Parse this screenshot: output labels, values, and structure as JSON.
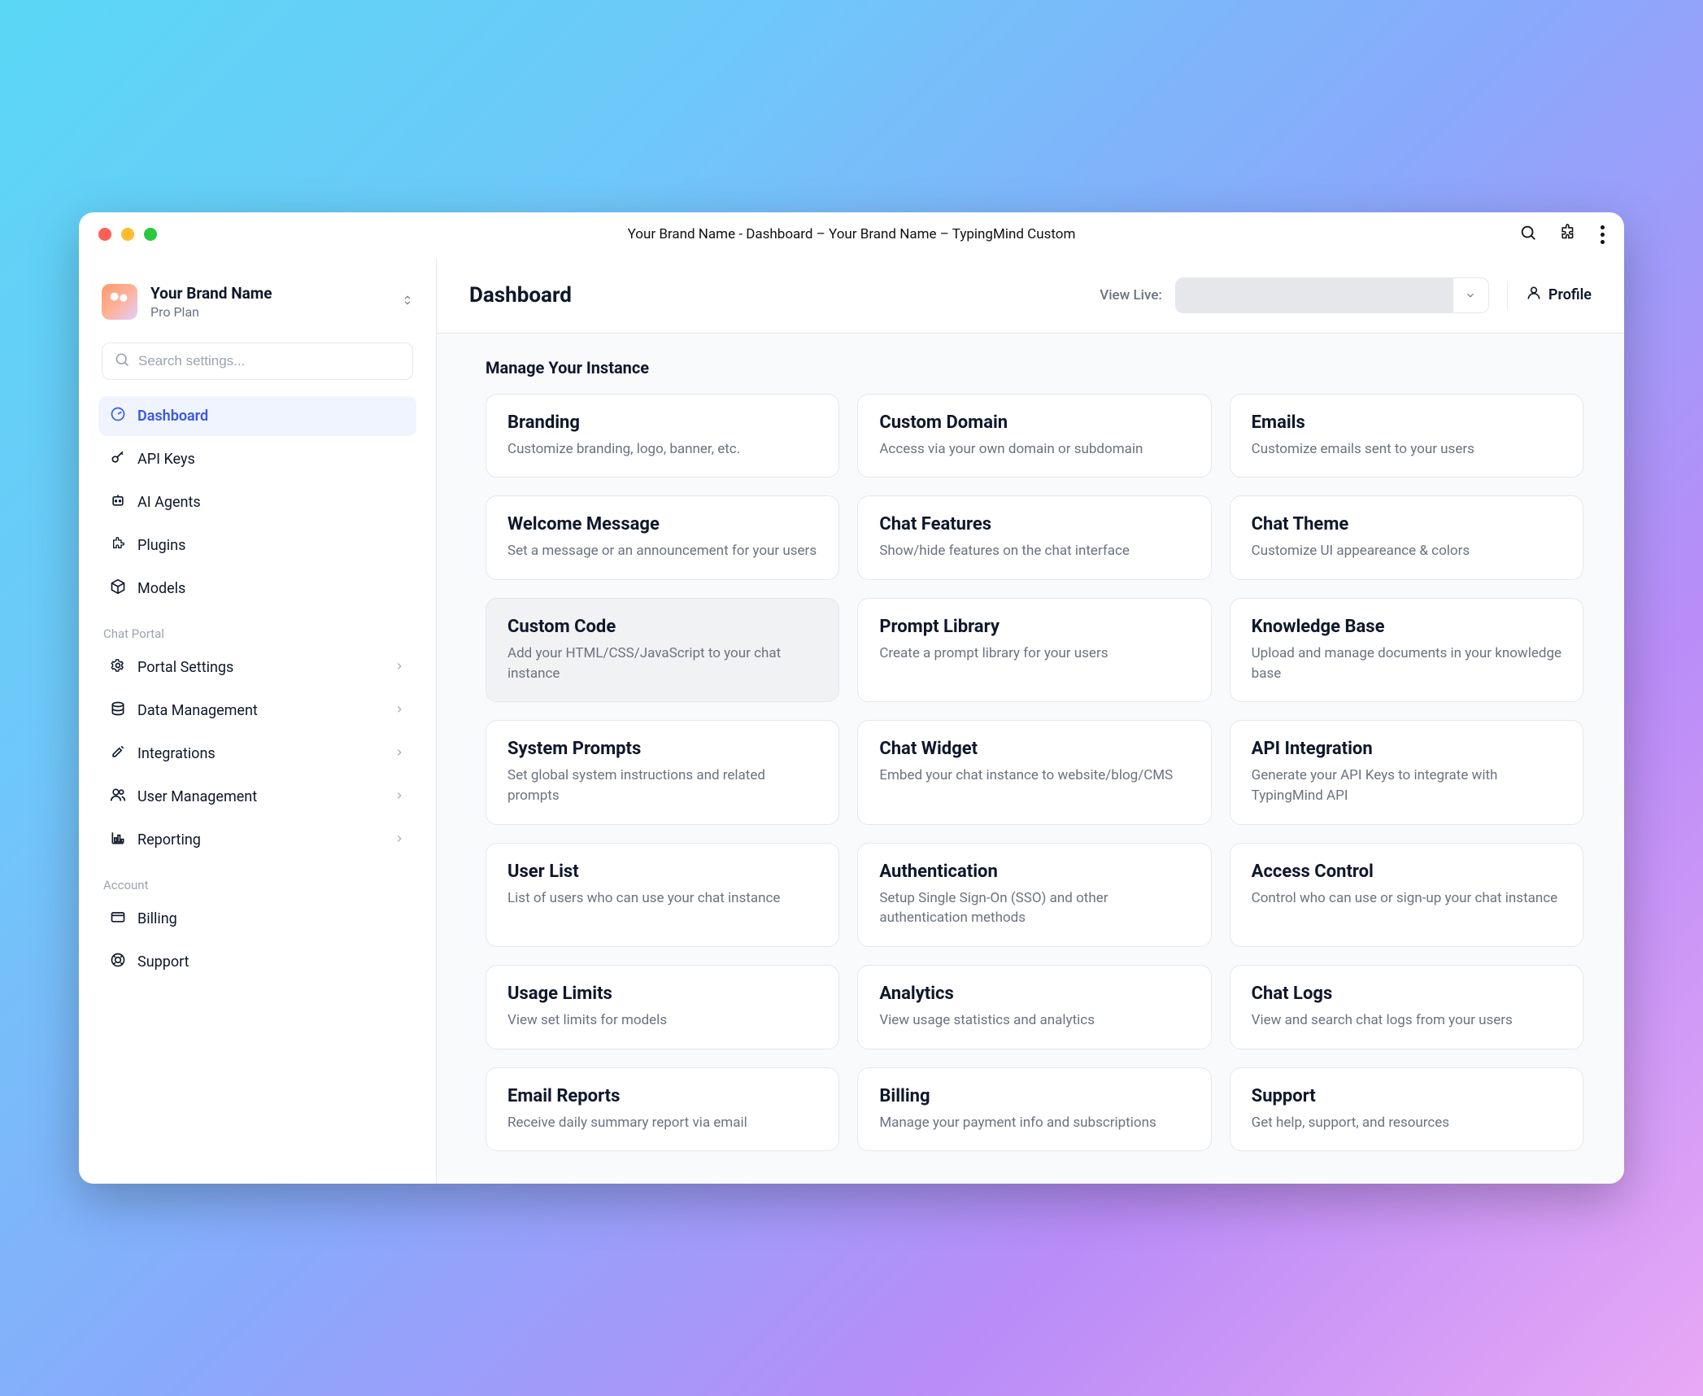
{
  "titlebar": {
    "title": "Your Brand Name - Dashboard – Your Brand Name – TypingMind Custom"
  },
  "brand": {
    "name": "Your Brand Name",
    "plan": "Pro Plan"
  },
  "search": {
    "placeholder": "Search settings..."
  },
  "nav": {
    "primary": [
      {
        "label": "Dashboard"
      },
      {
        "label": "API Keys"
      },
      {
        "label": "AI Agents"
      },
      {
        "label": "Plugins"
      },
      {
        "label": "Models"
      }
    ],
    "portal_label": "Chat Portal",
    "portal": [
      {
        "label": "Portal Settings"
      },
      {
        "label": "Data Management"
      },
      {
        "label": "Integrations"
      },
      {
        "label": "User Management"
      },
      {
        "label": "Reporting"
      }
    ],
    "account_label": "Account",
    "account": [
      {
        "label": "Billing"
      },
      {
        "label": "Support"
      }
    ]
  },
  "header": {
    "title": "Dashboard",
    "view_live_label": "View Live:",
    "profile_label": "Profile"
  },
  "content": {
    "section_title": "Manage Your Instance",
    "cards": [
      {
        "title": "Branding",
        "desc": "Customize branding, logo, banner, etc."
      },
      {
        "title": "Custom Domain",
        "desc": "Access via your own domain or subdomain"
      },
      {
        "title": "Emails",
        "desc": "Customize emails sent to your users"
      },
      {
        "title": "Welcome Message",
        "desc": "Set a message or an announcement for your users"
      },
      {
        "title": "Chat Features",
        "desc": "Show/hide features on the chat interface"
      },
      {
        "title": "Chat Theme",
        "desc": "Customize UI appeareance & colors"
      },
      {
        "title": "Custom Code",
        "desc": "Add your HTML/CSS/JavaScript to your chat instance"
      },
      {
        "title": "Prompt Library",
        "desc": "Create a prompt library for your users"
      },
      {
        "title": "Knowledge Base",
        "desc": "Upload and manage documents in your knowledge base"
      },
      {
        "title": "System Prompts",
        "desc": "Set global system instructions and related prompts"
      },
      {
        "title": "Chat Widget",
        "desc": "Embed your chat instance to website/blog/CMS"
      },
      {
        "title": "API Integration",
        "desc": "Generate your API Keys to integrate with TypingMind API"
      },
      {
        "title": "User List",
        "desc": "List of users who can use your chat instance"
      },
      {
        "title": "Authentication",
        "desc": "Setup Single Sign-On (SSO) and other authentication methods"
      },
      {
        "title": "Access Control",
        "desc": "Control who can use or sign-up your chat instance"
      },
      {
        "title": "Usage Limits",
        "desc": "View set limits for models"
      },
      {
        "title": "Analytics",
        "desc": "View usage statistics and analytics"
      },
      {
        "title": "Chat Logs",
        "desc": "View and search chat logs from your users"
      },
      {
        "title": "Email Reports",
        "desc": "Receive daily summary report via email"
      },
      {
        "title": "Billing",
        "desc": "Manage your payment info and subscriptions"
      },
      {
        "title": "Support",
        "desc": "Get help, support, and resources"
      }
    ]
  }
}
